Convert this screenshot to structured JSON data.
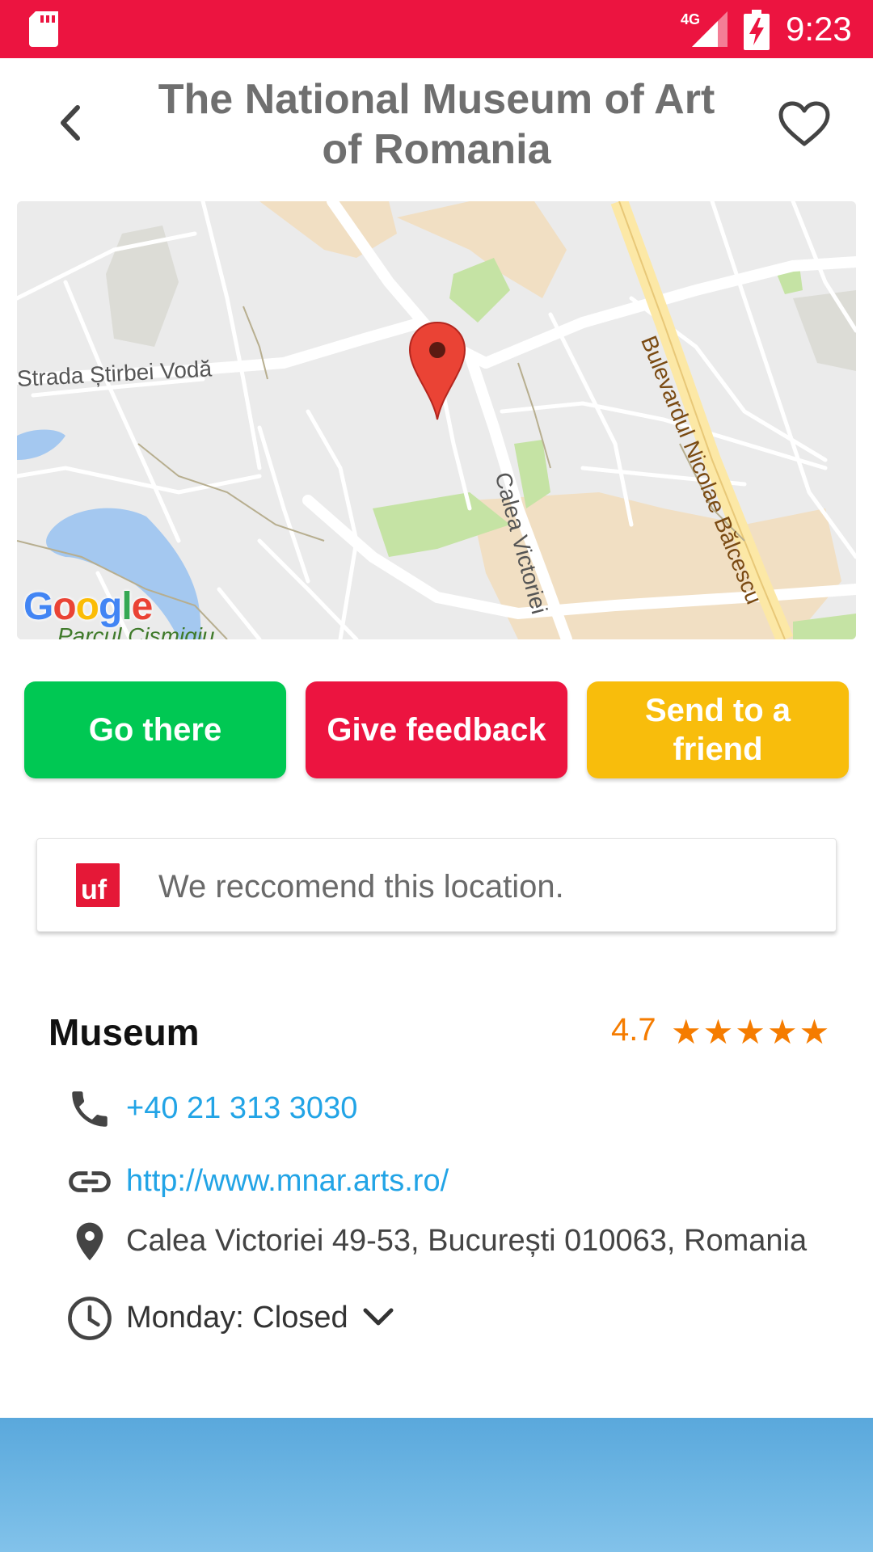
{
  "status_bar": {
    "time": "9:23",
    "network": "4G",
    "color": "#ec1440"
  },
  "header": {
    "title": "The National Museum of Art of Romania",
    "back_icon": "chevron-left-icon",
    "favorite_icon": "heart-outline-icon"
  },
  "map": {
    "labels": {
      "street_1": "Strada Știrbei Vodă",
      "street_2": "Calea Victoriei",
      "street_3": "Bulevardul Nicolae Bălcescu",
      "park": "Parcul Cișmigiu"
    },
    "logo": {
      "letters": [
        "G",
        "o",
        "o",
        "g",
        "l",
        "e"
      ],
      "colors": [
        "#4285f4",
        "#ea4335",
        "#fbbc05",
        "#4285f4",
        "#34a853",
        "#ea4335"
      ]
    },
    "pin_icon": "map-pin-icon"
  },
  "actions": {
    "go_there": "Go there",
    "give_feedback": "Give feedback",
    "send_to_friend": "Send to a friend",
    "colors": {
      "go": "#00c853",
      "feedback": "#ec1440",
      "send": "#f8bd0c"
    }
  },
  "recommendation": {
    "logo_text": "uf",
    "text": "We reccomend this location."
  },
  "details": {
    "category": "Museum",
    "rating": "4.7",
    "stars": "★★★★★",
    "phone": "+40 21 313 3030",
    "website": "http://www.mnar.arts.ro/",
    "address": "Calea Victoriei 49-53, București 010063, Romania",
    "hours": "Monday: Closed"
  }
}
